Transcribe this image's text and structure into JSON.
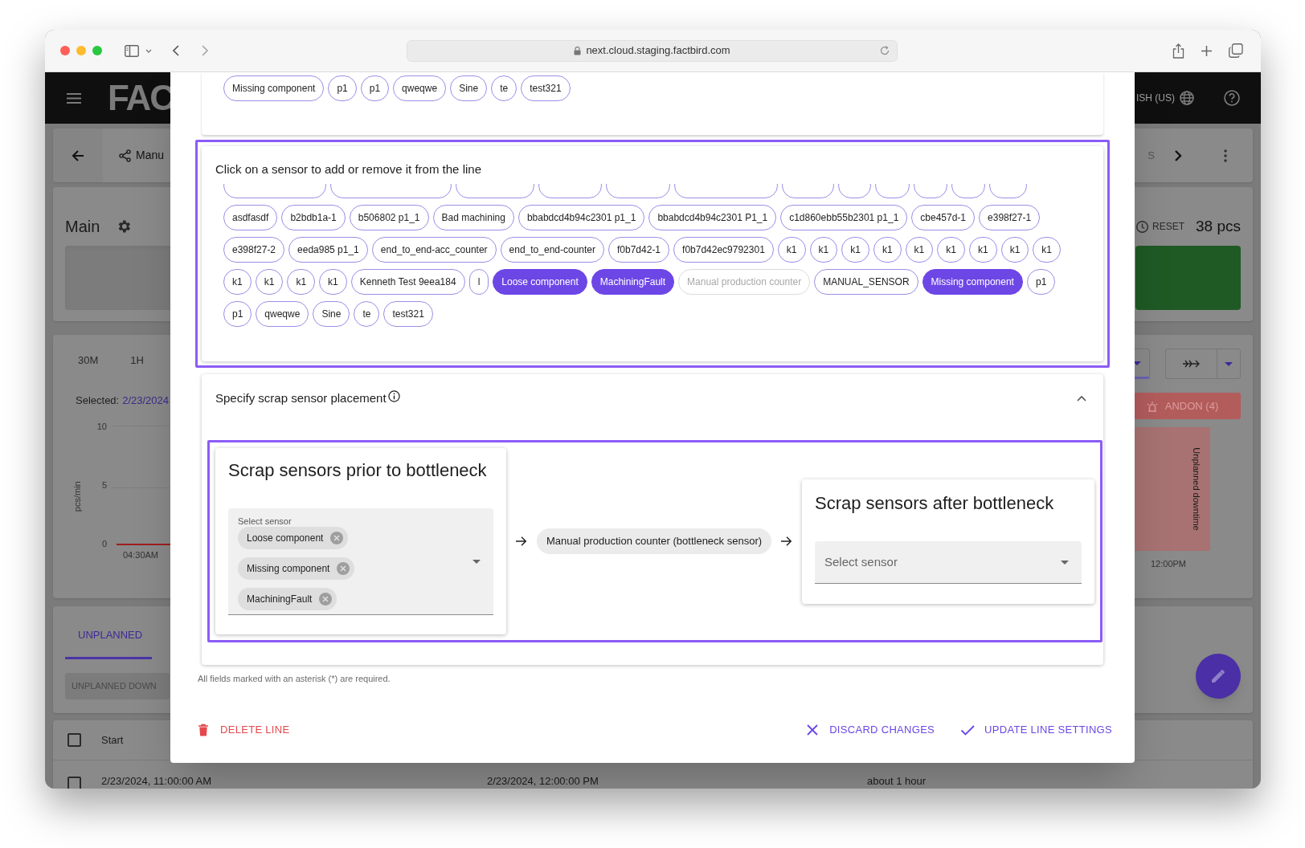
{
  "browser": {
    "url": "next.cloud.staging.factbird.com"
  },
  "app": {
    "logo": "FAC",
    "language": "ISH (US)",
    "breadcrumb": "Manu",
    "header_cut_text": "S",
    "line_title": "Main",
    "reset": "RESET",
    "count": "38 pcs",
    "ranges": [
      "30M",
      "1H"
    ],
    "selected_label": "Selected:",
    "selected_value": "2/23/2024",
    "andon": "ANDON (4)",
    "chart": {
      "y_label": "pcs/min",
      "y_ticks": [
        "10",
        "5",
        "0"
      ],
      "x_ticks": [
        "04:30AM",
        "12:00PM"
      ],
      "band_label": "Unplanned downtime"
    },
    "tabs": [
      {
        "label": "UNPLANNED",
        "selected": true
      }
    ],
    "unplanned_button": "UNPLANNED DOWN",
    "table": {
      "select_all": {
        "checked": false
      },
      "columns": [
        "Start"
      ],
      "rows": [
        {
          "checked": false,
          "cells": [
            "2/23/2024, 11:00:00 AM",
            "2/23/2024, 12:00:00 PM",
            "about 1 hour"
          ]
        }
      ]
    }
  },
  "top_chips": [
    "Missing component",
    "p1",
    "p1",
    "qweqwe",
    "Sine",
    "te",
    "test321"
  ],
  "picker": {
    "instruction": "Click on a sensor to add or remove it from the line",
    "sensors": [
      {
        "label": "asdfasdf",
        "selected": false,
        "disabled": false
      },
      {
        "label": "b2bdb1a-1",
        "selected": false,
        "disabled": false
      },
      {
        "label": "b506802 p1_1",
        "selected": false,
        "disabled": false
      },
      {
        "label": "Bad machining",
        "selected": false,
        "disabled": false
      },
      {
        "label": "bbabdcd4b94c2301 p1_1",
        "selected": false,
        "disabled": false
      },
      {
        "label": "bbabdcd4b94c2301 P1_1",
        "selected": false,
        "disabled": false
      },
      {
        "label": "c1d860ebb55b2301 p1_1",
        "selected": false,
        "disabled": false
      },
      {
        "label": "cbe457d-1",
        "selected": false,
        "disabled": false
      },
      {
        "label": "e398f27-1",
        "selected": false,
        "disabled": false
      },
      {
        "label": "e398f27-2",
        "selected": false,
        "disabled": false
      },
      {
        "label": "eeda985 p1_1",
        "selected": false,
        "disabled": false
      },
      {
        "label": "end_to_end-acc_counter",
        "selected": false,
        "disabled": false
      },
      {
        "label": "end_to_end-counter",
        "selected": false,
        "disabled": false
      },
      {
        "label": "f0b7d42-1",
        "selected": false,
        "disabled": false
      },
      {
        "label": "f0b7d42ec9792301",
        "selected": false,
        "disabled": false
      },
      {
        "label": "k1",
        "selected": false,
        "disabled": false
      },
      {
        "label": "k1",
        "selected": false,
        "disabled": false
      },
      {
        "label": "k1",
        "selected": false,
        "disabled": false
      },
      {
        "label": "k1",
        "selected": false,
        "disabled": false
      },
      {
        "label": "k1",
        "selected": false,
        "disabled": false
      },
      {
        "label": "k1",
        "selected": false,
        "disabled": false
      },
      {
        "label": "k1",
        "selected": false,
        "disabled": false
      },
      {
        "label": "k1",
        "selected": false,
        "disabled": false
      },
      {
        "label": "k1",
        "selected": false,
        "disabled": false
      },
      {
        "label": "k1",
        "selected": false,
        "disabled": false
      },
      {
        "label": "k1",
        "selected": false,
        "disabled": false
      },
      {
        "label": "k1",
        "selected": false,
        "disabled": false
      },
      {
        "label": "k1",
        "selected": false,
        "disabled": false
      },
      {
        "label": "Kenneth Test 9eea184",
        "selected": false,
        "disabled": false
      },
      {
        "label": "l",
        "selected": false,
        "disabled": false
      },
      {
        "label": "Loose component",
        "selected": true,
        "disabled": false
      },
      {
        "label": "MachiningFault",
        "selected": true,
        "disabled": false
      },
      {
        "label": "Manual production counter",
        "selected": false,
        "disabled": true
      },
      {
        "label": "MANUAL_SENSOR",
        "selected": false,
        "disabled": false
      },
      {
        "label": "Missing component",
        "selected": true,
        "disabled": false
      },
      {
        "label": "p1",
        "selected": false,
        "disabled": false
      },
      {
        "label": "p1",
        "selected": false,
        "disabled": false
      },
      {
        "label": "qweqwe",
        "selected": false,
        "disabled": false
      },
      {
        "label": "Sine",
        "selected": false,
        "disabled": false
      },
      {
        "label": "te",
        "selected": false,
        "disabled": false
      },
      {
        "label": "test321",
        "selected": false,
        "disabled": false
      }
    ]
  },
  "placement": {
    "title": "Specify scrap sensor placement",
    "expanded": true,
    "before": {
      "title": "Scrap sensors prior to bottleneck",
      "field_label": "Select sensor",
      "chips": [
        "Loose component",
        "Missing component",
        "MachiningFault"
      ]
    },
    "bottleneck": "Manual production counter (bottleneck sensor)",
    "after": {
      "title": "Scrap sensors after bottleneck",
      "placeholder": "Select sensor"
    }
  },
  "required_note": "All fields marked with an asterisk (*) are required.",
  "actions": [
    {
      "label": "DELETE LINE",
      "kind": "danger"
    },
    {
      "label": "DISCARD CHANGES",
      "kind": "discard"
    },
    {
      "label": "UPDATE LINE SETTINGS",
      "kind": "confirm"
    }
  ]
}
